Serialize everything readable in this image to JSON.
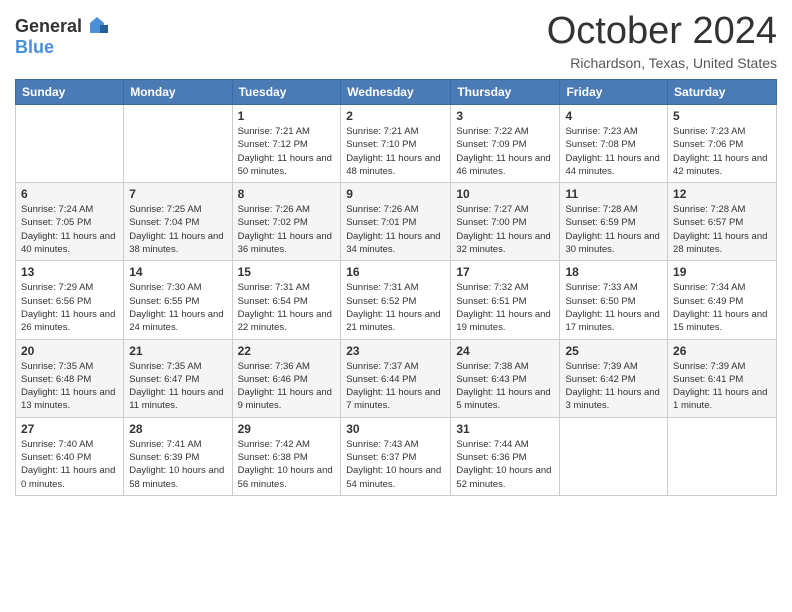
{
  "header": {
    "logo_general": "General",
    "logo_blue": "Blue",
    "month_title": "October 2024",
    "location": "Richardson, Texas, United States"
  },
  "days_of_week": [
    "Sunday",
    "Monday",
    "Tuesday",
    "Wednesday",
    "Thursday",
    "Friday",
    "Saturday"
  ],
  "weeks": [
    [
      {
        "day": "",
        "info": ""
      },
      {
        "day": "",
        "info": ""
      },
      {
        "day": "1",
        "info": "Sunrise: 7:21 AM\nSunset: 7:12 PM\nDaylight: 11 hours and 50 minutes."
      },
      {
        "day": "2",
        "info": "Sunrise: 7:21 AM\nSunset: 7:10 PM\nDaylight: 11 hours and 48 minutes."
      },
      {
        "day": "3",
        "info": "Sunrise: 7:22 AM\nSunset: 7:09 PM\nDaylight: 11 hours and 46 minutes."
      },
      {
        "day": "4",
        "info": "Sunrise: 7:23 AM\nSunset: 7:08 PM\nDaylight: 11 hours and 44 minutes."
      },
      {
        "day": "5",
        "info": "Sunrise: 7:23 AM\nSunset: 7:06 PM\nDaylight: 11 hours and 42 minutes."
      }
    ],
    [
      {
        "day": "6",
        "info": "Sunrise: 7:24 AM\nSunset: 7:05 PM\nDaylight: 11 hours and 40 minutes."
      },
      {
        "day": "7",
        "info": "Sunrise: 7:25 AM\nSunset: 7:04 PM\nDaylight: 11 hours and 38 minutes."
      },
      {
        "day": "8",
        "info": "Sunrise: 7:26 AM\nSunset: 7:02 PM\nDaylight: 11 hours and 36 minutes."
      },
      {
        "day": "9",
        "info": "Sunrise: 7:26 AM\nSunset: 7:01 PM\nDaylight: 11 hours and 34 minutes."
      },
      {
        "day": "10",
        "info": "Sunrise: 7:27 AM\nSunset: 7:00 PM\nDaylight: 11 hours and 32 minutes."
      },
      {
        "day": "11",
        "info": "Sunrise: 7:28 AM\nSunset: 6:59 PM\nDaylight: 11 hours and 30 minutes."
      },
      {
        "day": "12",
        "info": "Sunrise: 7:28 AM\nSunset: 6:57 PM\nDaylight: 11 hours and 28 minutes."
      }
    ],
    [
      {
        "day": "13",
        "info": "Sunrise: 7:29 AM\nSunset: 6:56 PM\nDaylight: 11 hours and 26 minutes."
      },
      {
        "day": "14",
        "info": "Sunrise: 7:30 AM\nSunset: 6:55 PM\nDaylight: 11 hours and 24 minutes."
      },
      {
        "day": "15",
        "info": "Sunrise: 7:31 AM\nSunset: 6:54 PM\nDaylight: 11 hours and 22 minutes."
      },
      {
        "day": "16",
        "info": "Sunrise: 7:31 AM\nSunset: 6:52 PM\nDaylight: 11 hours and 21 minutes."
      },
      {
        "day": "17",
        "info": "Sunrise: 7:32 AM\nSunset: 6:51 PM\nDaylight: 11 hours and 19 minutes."
      },
      {
        "day": "18",
        "info": "Sunrise: 7:33 AM\nSunset: 6:50 PM\nDaylight: 11 hours and 17 minutes."
      },
      {
        "day": "19",
        "info": "Sunrise: 7:34 AM\nSunset: 6:49 PM\nDaylight: 11 hours and 15 minutes."
      }
    ],
    [
      {
        "day": "20",
        "info": "Sunrise: 7:35 AM\nSunset: 6:48 PM\nDaylight: 11 hours and 13 minutes."
      },
      {
        "day": "21",
        "info": "Sunrise: 7:35 AM\nSunset: 6:47 PM\nDaylight: 11 hours and 11 minutes."
      },
      {
        "day": "22",
        "info": "Sunrise: 7:36 AM\nSunset: 6:46 PM\nDaylight: 11 hours and 9 minutes."
      },
      {
        "day": "23",
        "info": "Sunrise: 7:37 AM\nSunset: 6:44 PM\nDaylight: 11 hours and 7 minutes."
      },
      {
        "day": "24",
        "info": "Sunrise: 7:38 AM\nSunset: 6:43 PM\nDaylight: 11 hours and 5 minutes."
      },
      {
        "day": "25",
        "info": "Sunrise: 7:39 AM\nSunset: 6:42 PM\nDaylight: 11 hours and 3 minutes."
      },
      {
        "day": "26",
        "info": "Sunrise: 7:39 AM\nSunset: 6:41 PM\nDaylight: 11 hours and 1 minute."
      }
    ],
    [
      {
        "day": "27",
        "info": "Sunrise: 7:40 AM\nSunset: 6:40 PM\nDaylight: 11 hours and 0 minutes."
      },
      {
        "day": "28",
        "info": "Sunrise: 7:41 AM\nSunset: 6:39 PM\nDaylight: 10 hours and 58 minutes."
      },
      {
        "day": "29",
        "info": "Sunrise: 7:42 AM\nSunset: 6:38 PM\nDaylight: 10 hours and 56 minutes."
      },
      {
        "day": "30",
        "info": "Sunrise: 7:43 AM\nSunset: 6:37 PM\nDaylight: 10 hours and 54 minutes."
      },
      {
        "day": "31",
        "info": "Sunrise: 7:44 AM\nSunset: 6:36 PM\nDaylight: 10 hours and 52 minutes."
      },
      {
        "day": "",
        "info": ""
      },
      {
        "day": "",
        "info": ""
      }
    ]
  ]
}
